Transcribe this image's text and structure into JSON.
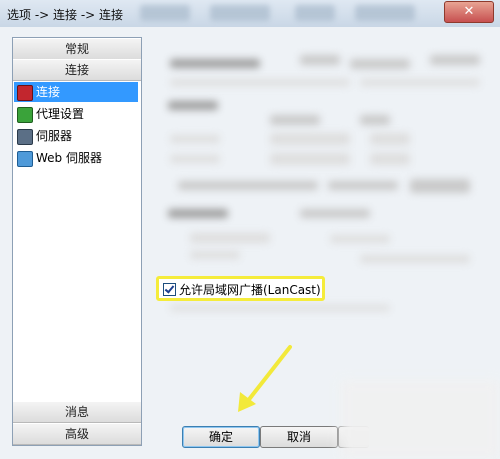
{
  "window": {
    "title": "选项 -> 连接 -> 连接",
    "close_glyph": "✕"
  },
  "sidebar": {
    "headers_top": [
      "常规",
      "连接"
    ],
    "items": [
      {
        "label": "连接",
        "icon": "connection-icon",
        "selected": true
      },
      {
        "label": "代理设置",
        "icon": "proxy-icon",
        "selected": false
      },
      {
        "label": "伺服器",
        "icon": "server-icon",
        "selected": false
      },
      {
        "label": "Web 伺服器",
        "icon": "web-server-icon",
        "selected": false
      }
    ],
    "headers_bottom": [
      "消息",
      "高级"
    ]
  },
  "content": {
    "lancast_label": "允许局域网广播(LanCast)",
    "lancast_checked": true
  },
  "buttons": {
    "ok": "确定",
    "cancel": "取消"
  },
  "colors": {
    "selection": "#3399ff",
    "highlight": "#f5ec3b",
    "arrow": "#f2e93a"
  }
}
